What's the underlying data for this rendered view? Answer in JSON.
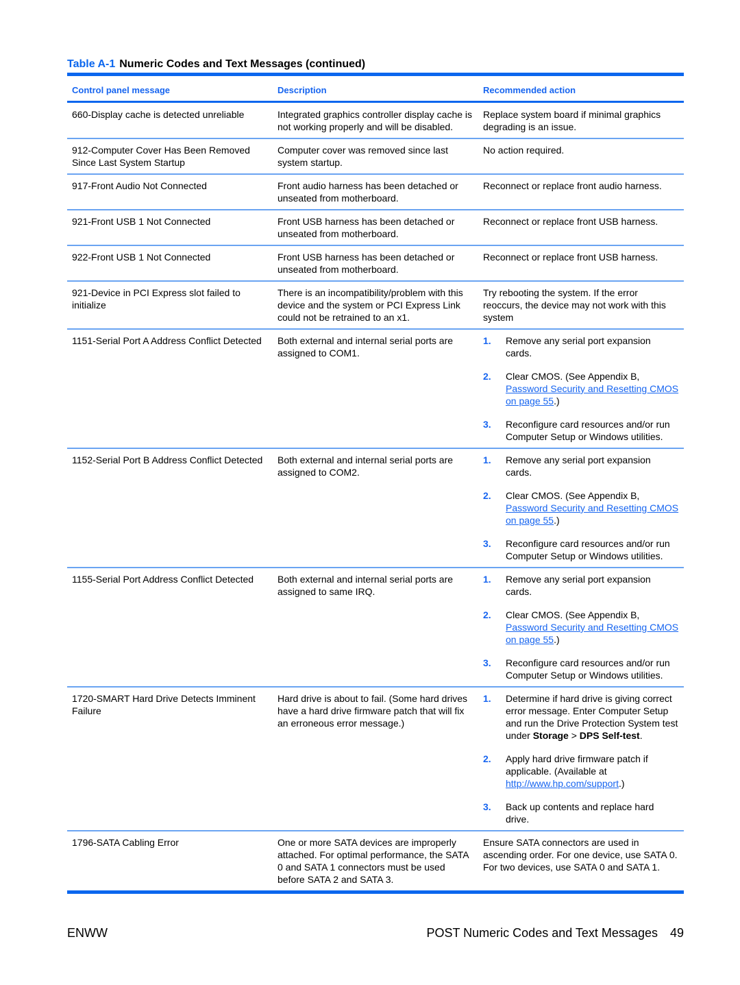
{
  "caption": {
    "label": "Table A-1",
    "title": "Numeric Codes and Text Messages (continued)"
  },
  "table": {
    "headers": [
      "Control panel message",
      "Description",
      "Recommended action"
    ],
    "rows": [
      {
        "message": "660-Display cache is detected unreliable",
        "description": "Integrated graphics controller display cache is not working properly and will be disabled.",
        "action": "Replace system board if minimal graphics degrading is an issue."
      },
      {
        "message": "912-Computer Cover Has Been Removed Since Last System Startup",
        "description": "Computer cover was removed since last system startup.",
        "action": "No action required."
      },
      {
        "message": "917-Front Audio Not Connected",
        "description": "Front audio harness has been detached or unseated from motherboard.",
        "action": "Reconnect or replace front audio harness."
      },
      {
        "message": "921-Front USB 1 Not Connected",
        "description": "Front USB harness has been detached or unseated from motherboard.",
        "action": "Reconnect or replace front USB harness."
      },
      {
        "message": "922-Front USB 1 Not Connected",
        "description": "Front USB harness has been detached or unseated from motherboard.",
        "action": "Reconnect or replace front USB harness."
      },
      {
        "message": "921-Device in PCI Express slot failed to initialize",
        "description": "There is an incompatibility/problem with this device and the system or PCI Express Link could not be retrained to an x1.",
        "action": "Try rebooting the system. If the error reoccurs, the device may not work with this system"
      },
      {
        "message": "1151-Serial Port A Address Conflict Detected",
        "description": "Both external and internal serial ports are assigned to COM1.",
        "steps": [
          {
            "num": "1.",
            "text": "Remove any serial port expansion cards."
          },
          {
            "num": "2.",
            "text": "Clear CMOS. (See Appendix B, ",
            "link": "Password Security and Resetting CMOS on page 55",
            "after": ".)"
          },
          {
            "num": "3.",
            "text": "Reconfigure card resources and/or run Computer Setup or Windows utilities."
          }
        ]
      },
      {
        "message": "1152-Serial Port B Address Conflict Detected",
        "description": "Both external and internal serial ports are assigned to COM2.",
        "steps": [
          {
            "num": "1.",
            "text": "Remove any serial port expansion cards."
          },
          {
            "num": "2.",
            "text": "Clear CMOS. (See Appendix B, ",
            "link": "Password Security and Resetting CMOS on page 55",
            "after": ".)"
          },
          {
            "num": "3.",
            "text": "Reconfigure card resources and/or run Computer Setup or Windows utilities."
          }
        ]
      },
      {
        "message": "1155-Serial Port Address Conflict Detected",
        "description": "Both external and internal serial ports are assigned to same IRQ.",
        "steps": [
          {
            "num": "1.",
            "text": "Remove any serial port expansion cards."
          },
          {
            "num": "2.",
            "text": "Clear CMOS. (See Appendix B, ",
            "link": "Password Security and Resetting CMOS on page 55",
            "after": ".)"
          },
          {
            "num": "3.",
            "text": "Reconfigure card resources and/or run Computer Setup or Windows utilities."
          }
        ]
      },
      {
        "message": "1720-SMART Hard Drive Detects Imminent Failure",
        "description": "Hard drive is about to fail. (Some hard drives have a hard drive firmware patch that will fix an erroneous error message.)",
        "steps": [
          {
            "num": "1.",
            "text": "Determine if hard drive is giving correct error message. Enter Computer Setup and run the Drive Protection System test under ",
            "bold1": "Storage",
            "mid": " > ",
            "bold2": "DPS Self-test",
            "after": "."
          },
          {
            "num": "2.",
            "text": "Apply hard drive firmware patch if applicable. (Available at ",
            "link": "http://www.hp.com/support",
            "after": ".)"
          },
          {
            "num": "3.",
            "text": "Back up contents and replace hard drive."
          }
        ]
      },
      {
        "message": "1796-SATA Cabling Error",
        "description": "One or more SATA devices are improperly attached. For optimal performance, the SATA 0 and SATA 1 connectors must be used before SATA 2 and SATA 3.",
        "action": "Ensure SATA connectors are used in ascending order. For one device, use SATA 0. For two devices, use SATA 0 and SATA 1."
      }
    ]
  },
  "footer": {
    "left": "ENWW",
    "section": "POST Numeric Codes and Text Messages",
    "page": "49"
  }
}
